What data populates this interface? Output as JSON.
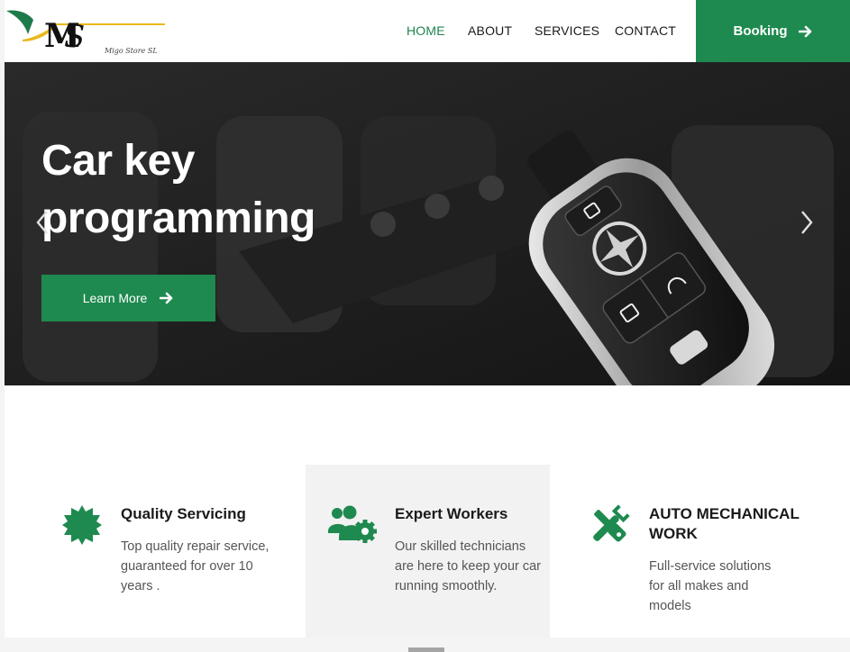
{
  "header": {
    "logo_text": "MS",
    "logo_tagline": "Migo Store SL",
    "nav": [
      {
        "label": "HOME",
        "active": true
      },
      {
        "label": "ABOUT",
        "active": false
      },
      {
        "label": "SERVICES",
        "active": false
      },
      {
        "label": "CONTACT",
        "active": false
      }
    ],
    "booking_label": "Booking",
    "booking_icon": "arrow-right-icon"
  },
  "hero": {
    "title": "Car key programming",
    "button_label": "Learn More",
    "button_icon": "arrow-right-icon",
    "prev_icon": "chevron-left-icon",
    "next_icon": "chevron-right-icon"
  },
  "features": [
    {
      "icon": "badge-icon",
      "title": "Quality Servicing",
      "text": "Top quality repair service, guaranteed for over 10 years ."
    },
    {
      "icon": "users-gear-icon",
      "title": "Expert Workers",
      "text": "Our skilled technicians are here to keep your car running smoothly."
    },
    {
      "icon": "tools-icon",
      "title": "AUTO MECHANICAL WORK",
      "text": "Full-service solutions for all makes and models"
    }
  ],
  "colors": {
    "accent": "#1e8a4f",
    "nav_active": "#1e8450",
    "feature_highlight_bg": "#f2f2f2",
    "logo_yellow": "#e9b81a"
  }
}
